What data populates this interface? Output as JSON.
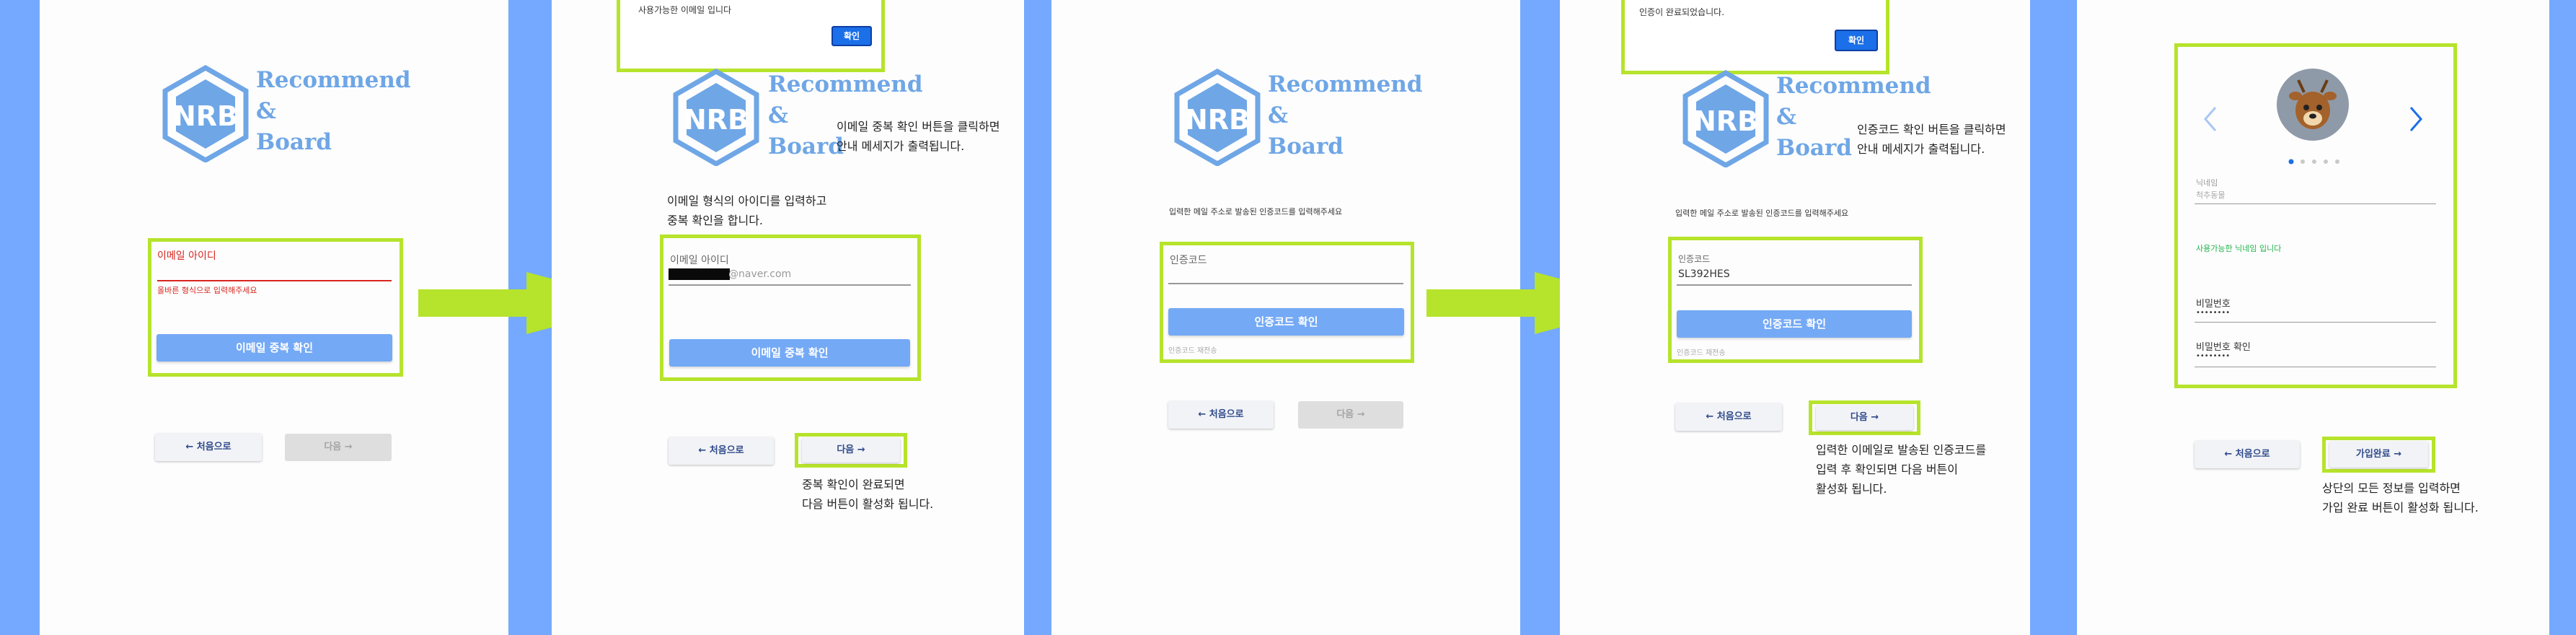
{
  "logo": {
    "line1": "Recommend",
    "line2": "&",
    "line3": "Board",
    "mark": "NRB"
  },
  "nav": {
    "home": "← 처음으로",
    "next": "다음 →",
    "signup_done": "가입완료 →"
  },
  "panel1": {
    "email_label": "이메일 아이디",
    "error": "올바른 형식으로 입력해주세요",
    "check_button": "이메일 중복 확인"
  },
  "panel2": {
    "dialog_text": "사용가능한 이메일 입니다",
    "ok": "확인",
    "callout": "이메일 중복 확인 버튼을 클릭하면\n안내 메세지가 출력됩니다.",
    "intro": "이메일 형식의 아이디를 입력하고\n중복 확인을 합니다.",
    "email_label": "이메일 아이디",
    "email_value": "@naver.com",
    "check_button": "이메일 중복 확인",
    "note": "중복 확인이 완료되면\n다음 버튼이 활성화 됩니다."
  },
  "panel3": {
    "instruction": "입력한 메일 주소로 발송된 인증코드를 입력해주세요",
    "code_label": "인증코드",
    "verify_button": "인증코드 확인",
    "resend": "인증코드 재전송"
  },
  "panel4": {
    "dialog_text": "인증이 완료되었습니다.",
    "ok": "확인",
    "callout": "인증코드 확인 버튼을 클릭하면\n안내 메세지가 출력됩니다.",
    "instruction": "입력한 메일 주소로 발송된 인증코드를 입력해주세요",
    "code_label": "인증코드",
    "code_value": "SL392HES",
    "verify_button": "인증코드 확인",
    "resend": "인증코드 재전송",
    "note": "입력한 이메일로 발송된 인증코드를\n입력 후 확인되면 다음 버튼이\n활성화 됩니다."
  },
  "panel5": {
    "nickname_label": "닉네임",
    "nickname_value": "척추동물",
    "nickname_ok": "사용가능한 닉네임 입니다",
    "password_label": "비밀번호",
    "password_value": "••••••••",
    "password_confirm_label": "비밀번호 확인",
    "password_confirm_value": "••••••••",
    "note": "상단의 모든 정보를 입력하면\n가입 완료 버튼이 활성화 됩니다.",
    "avatar": "deer-avatar"
  },
  "colors": {
    "accent": "#b6e32b",
    "primary": "#74a9f5",
    "background": "#74a9ff",
    "error": "#d7261f",
    "success": "#21b34b"
  }
}
